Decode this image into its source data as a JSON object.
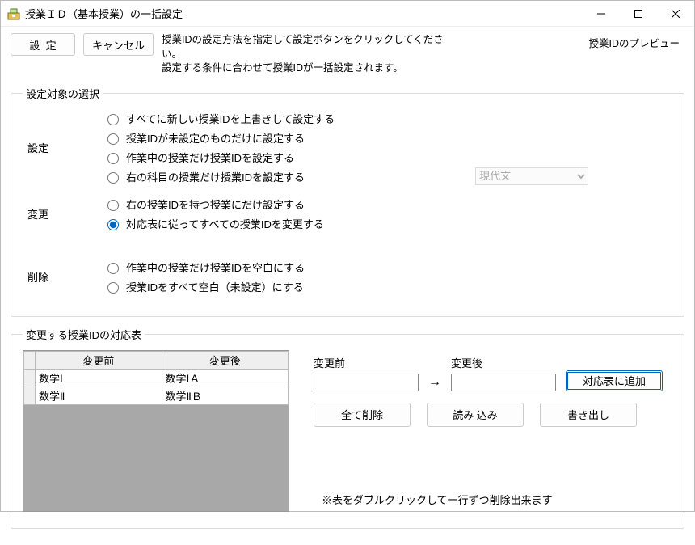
{
  "window": {
    "title": "授業ＩＤ（基本授業）の一括設定"
  },
  "top": {
    "set_label": "設  定",
    "cancel_label": "キャンセル",
    "instruction1": "授業IDの設定方法を指定して設定ボタンをクリックしてください。",
    "instruction2": "設定する条件に合わせて授業IDが一括設定されます。",
    "preview_label": "授業IDのプレビュー"
  },
  "group1": {
    "legend": "設定対象の選択",
    "set_label": "設定",
    "change_label": "変更",
    "delete_label": "削除",
    "opt_overwrite_all": "すべてに新しい授業IDを上書きして設定する",
    "opt_only_unset": "授業IDが未設定のものだけに設定する",
    "opt_only_working": "作業中の授業だけ授業IDを設定する",
    "opt_only_right_subject": "右の科目の授業だけ授業IDを設定する",
    "subject_selected": "現代文",
    "opt_only_right_id": "右の授業IDを持つ授業にだけ設定する",
    "opt_change_all_by_table": "対応表に従ってすべての授業IDを変更する",
    "opt_blank_working": "作業中の授業だけ授業IDを空白にする",
    "opt_blank_all": "授業IDをすべて空白（未設定）にする"
  },
  "group2": {
    "legend": "変更する授業IDの対応表",
    "col_before": "変更前",
    "col_after": "変更後",
    "rows": [
      {
        "before": "数学Ⅰ",
        "after": "数学ⅠＡ"
      },
      {
        "before": "数学Ⅱ",
        "after": "数学ⅡＢ"
      }
    ],
    "field_before_label": "変更前",
    "field_after_label": "変更後",
    "arrow": "→",
    "add_button": "対応表に追加",
    "delete_all_button": "全て削除",
    "load_button": "読み 込み",
    "export_button": "書き出し",
    "hint": "※表をダブルクリックして一行ずつ削除出来ます"
  }
}
